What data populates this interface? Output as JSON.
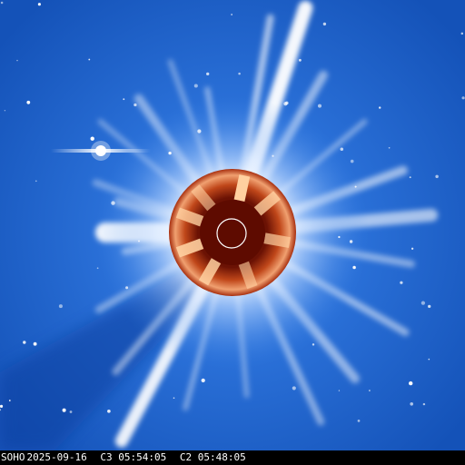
{
  "caption": {
    "observatory": "SOHO",
    "date": "2025-09-16",
    "c3_time": "C3 05:54:05",
    "c2_time": "C2 05:48:05"
  },
  "colors": {
    "sky": "#1d5fc4",
    "corona": "#ffffff",
    "occulter_disk": "#b33b12",
    "occulter_core": "#5e0b00",
    "sun_circle": "#ffffff",
    "caption_bg": "#000000",
    "caption_text": "#ffffff"
  }
}
